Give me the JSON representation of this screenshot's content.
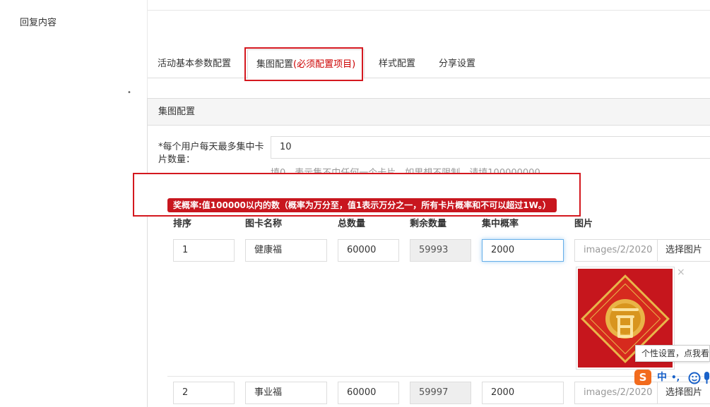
{
  "sidebar": {
    "reply_content_label": "回复内容"
  },
  "tabs": [
    {
      "label": "活动基本参数配置"
    },
    {
      "label": "集图配置",
      "suffix": "(必须配置项目)"
    },
    {
      "label": "样式配置"
    },
    {
      "label": "分享设置"
    }
  ],
  "panel": {
    "heading": "集图配置",
    "daily_limit": {
      "label": "*每个用户每天最多集中卡片数量：",
      "value": "10",
      "help": "填0，表示集不中任何一个卡片。如果想不限制，请填100000000"
    },
    "notice": "奖概率:值100000以内的数（概率为万分至，值1表示万分之一，所有卡片概率和不可以超过1W。）"
  },
  "table": {
    "headers": [
      "排序",
      "图卡名称",
      "总数量",
      "剩余数量",
      "集中概率",
      "图片"
    ],
    "rows": [
      {
        "sort": "1",
        "name": "健康福",
        "total": "60000",
        "remaining": "59993",
        "probability": "2000",
        "image_path": "images/2/2020",
        "select_label": "选择图片"
      },
      {
        "sort": "2",
        "name": "事业福",
        "total": "60000",
        "remaining": "59997",
        "probability": "2000",
        "image_path": "images/2/2020",
        "select_label": "选择图片"
      }
    ],
    "thumb_close": "×"
  },
  "ime": {
    "tooltip": "个性设置，点我看",
    "logo": "S",
    "lang": "中",
    "punct": "•,",
    "emoji_icon": "smile-icon",
    "mic_icon": "mic-icon"
  },
  "colors": {
    "accent_red": "#d4181f",
    "notice_bg": "#c8161e",
    "focus_blue": "#66afe9"
  }
}
